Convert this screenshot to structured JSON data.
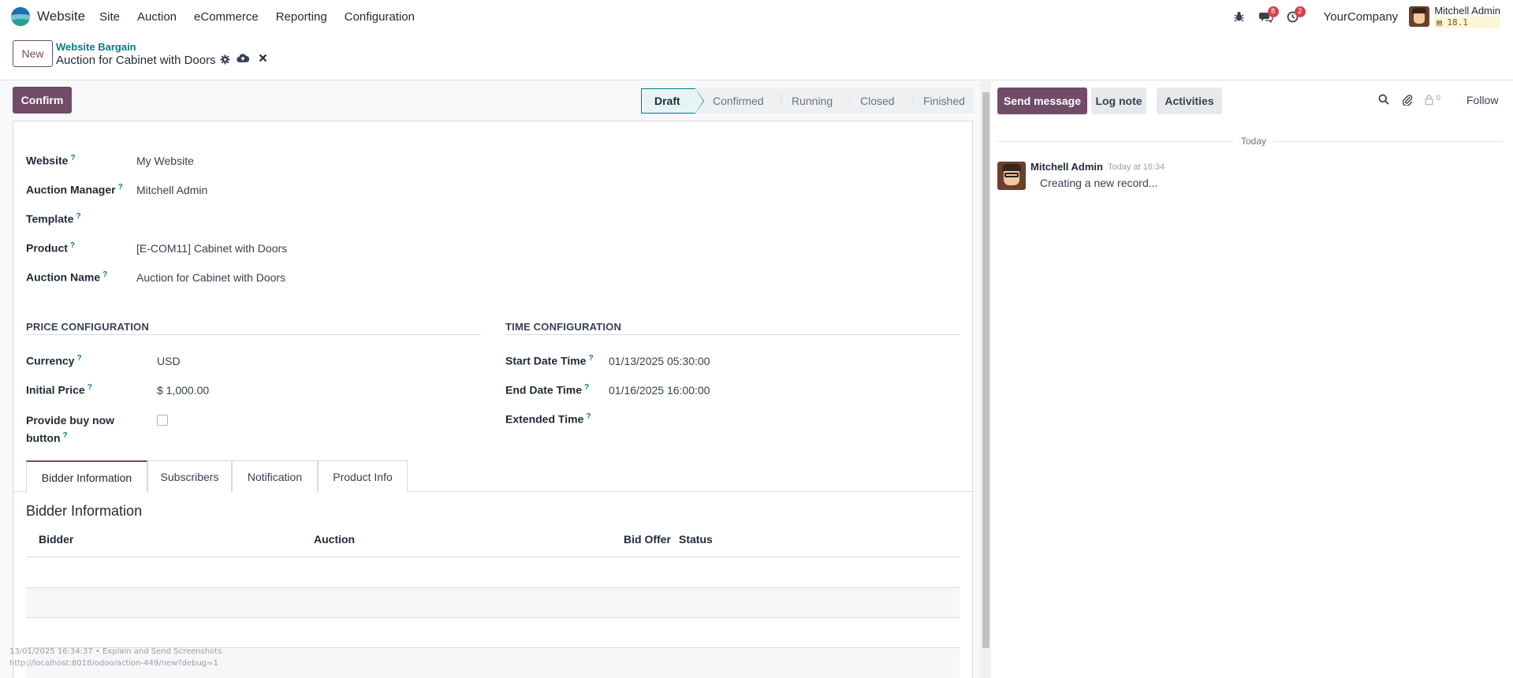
{
  "navbar": {
    "app_name": "Website",
    "menu": [
      "Site",
      "Auction",
      "eCommerce",
      "Reporting",
      "Configuration"
    ],
    "messages_count": "8",
    "activities_count": "2",
    "company": "YourCompany",
    "user_name": "Mitchell Admin",
    "db_version": "▤ 18.1"
  },
  "control": {
    "new_label": "New",
    "breadcrumb_parent": "Website Bargain",
    "record_title": "Auction for Cabinet with Doors"
  },
  "form": {
    "confirm_label": "Confirm",
    "stages": [
      "Draft",
      "Confirmed",
      "Running",
      "Closed",
      "Finished"
    ],
    "active_stage": "Draft",
    "fields": {
      "website_label": "Website",
      "website_value": "My Website",
      "manager_label": "Auction Manager",
      "manager_value": "Mitchell Admin",
      "template_label": "Template",
      "product_label": "Product",
      "product_value": "[E-COM11] Cabinet with Doors",
      "auction_name_label": "Auction Name",
      "auction_name_value": "Auction for Cabinet with Doors"
    },
    "price_group": {
      "title": "PRICE CONFIGURATION",
      "currency_label": "Currency",
      "currency_value": "USD",
      "initial_price_label": "Initial Price",
      "initial_price_value": "$ 1,000.00",
      "buy_now_label_line1": "Provide buy now",
      "buy_now_label_line2": "button",
      "buy_now_checked": false
    },
    "time_group": {
      "title": "TIME CONFIGURATION",
      "start_label": "Start Date Time",
      "start_value": "01/13/2025 05:30:00",
      "end_label": "End Date Time",
      "end_value": "01/16/2025 16:00:00",
      "extended_label": "Extended Time"
    },
    "help_mark": "?",
    "tabs": [
      "Bidder Information",
      "Subscribers",
      "Notification",
      "Product Info"
    ],
    "active_tab": "Bidder Information",
    "section_title": "Bidder Information",
    "table_columns": [
      "Bidder",
      "Auction",
      "Bid Offer",
      "Status"
    ],
    "table_rows": [],
    "footer_line1": "13/01/2025 16:34:37 • Explain and Send Screenshots",
    "footer_line2": "http://localhost:8018/odoo/action-449/new?debug=1"
  },
  "chatter": {
    "send_message_label": "Send message",
    "log_note_label": "Log note",
    "activities_label": "Activities",
    "followers_count": "0",
    "follow_label": "Follow",
    "date_separator": "Today",
    "messages": [
      {
        "author": "Mitchell Admin",
        "time": "Today at 16:34",
        "body": "Creating a new record..."
      }
    ]
  },
  "colors": {
    "primary": "#714b67",
    "link": "#017e84",
    "badge": "#d9434c"
  },
  "icons": [
    "bug-icon",
    "chat-icon",
    "clock-icon",
    "gear-icon",
    "cloud-upload-icon",
    "close-icon",
    "search-icon",
    "paperclip-icon",
    "user-lock-icon"
  ]
}
